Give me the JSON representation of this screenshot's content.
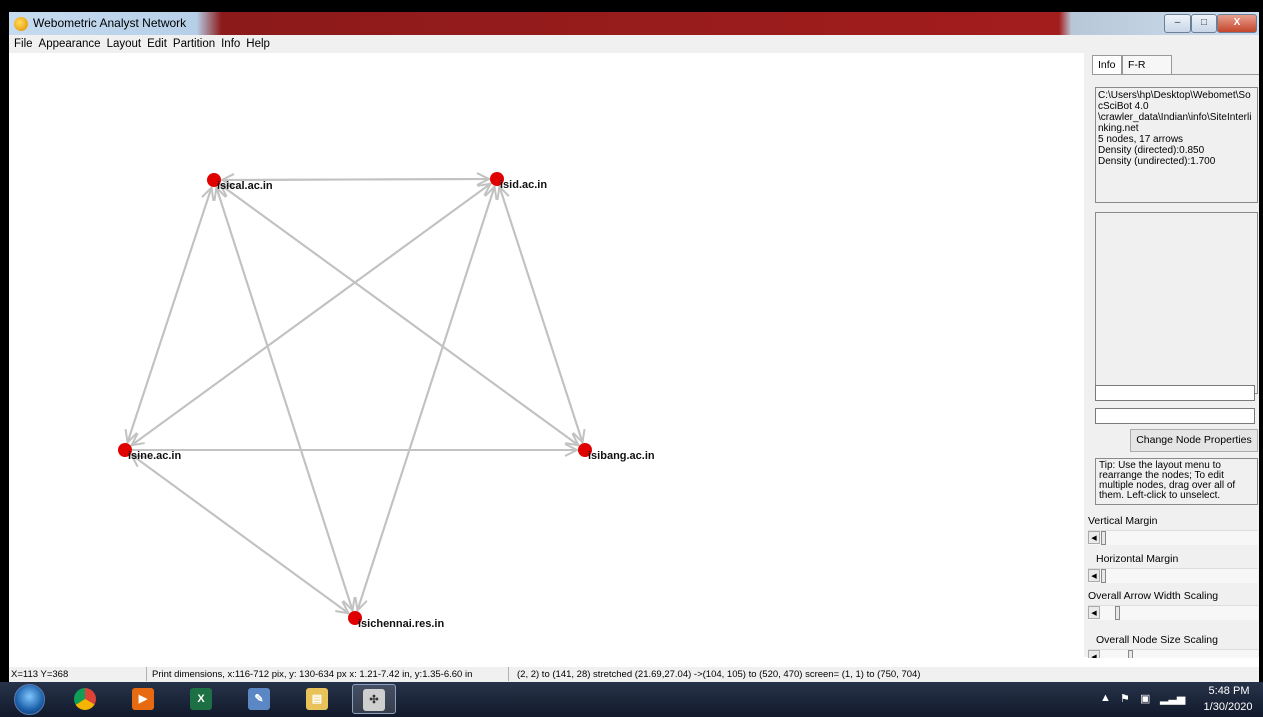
{
  "window": {
    "title": "Webometric Analyst Network",
    "caption_buttons": {
      "minimize": "–",
      "maximize": "□",
      "close": "X"
    }
  },
  "menubar": {
    "items": [
      "File",
      "Appearance",
      "Layout",
      "Edit",
      "Partition",
      "Info",
      "Help"
    ]
  },
  "network": {
    "node_color": "#e00000",
    "edge_color": "#c2c2c2",
    "nodes": [
      {
        "id": "isical",
        "label": "isical.ac.in"
      },
      {
        "id": "isid",
        "label": "isid.ac.in"
      },
      {
        "id": "isine",
        "label": "isine.ac.in"
      },
      {
        "id": "isibang",
        "label": "isibang.ac.in"
      },
      {
        "id": "isichennai",
        "label": "isichennai.res.in"
      }
    ],
    "edges": [
      [
        "isical",
        "isid"
      ],
      [
        "isid",
        "isical"
      ],
      [
        "isical",
        "isine"
      ],
      [
        "isine",
        "isical"
      ],
      [
        "isical",
        "isibang"
      ],
      [
        "isibang",
        "isical"
      ],
      [
        "isichennai",
        "isical"
      ],
      [
        "isid",
        "isibang"
      ],
      [
        "isine",
        "isid"
      ],
      [
        "isid",
        "isine"
      ],
      [
        "isichennai",
        "isid"
      ],
      [
        "isibang",
        "isid"
      ],
      [
        "isine",
        "isibang"
      ],
      [
        "isine",
        "isichennai"
      ],
      [
        "isichennai",
        "isine"
      ],
      [
        "isical",
        "isichennai"
      ],
      [
        "isid",
        "isichennai"
      ]
    ]
  },
  "sidepanel": {
    "tabs": [
      "Info",
      "F-R"
    ],
    "info_lines": [
      "C:\\Users\\hp\\Desktop\\Webomet\\So",
      "cSciBot 4.0",
      "\\crawler_data\\Indian\\info\\SiteInterli",
      "nking.net",
      "5 nodes, 17 arrows",
      "Density (directed):0.850",
      "Density (undirected):1.700"
    ],
    "field1_value": "",
    "field2_value": "",
    "change_node_button": "Change Node Properties",
    "tip_lines": [
      "Tip: Use the layout menu to",
      "rearrange the nodes; To edit",
      "multiple nodes, drag over all of",
      "them. Left-click to unselect."
    ],
    "sliders": {
      "vertical_margin": "Vertical Margin",
      "horizontal_margin": "Horizontal Margin",
      "arrow_width": "Overall Arrow Width Scaling",
      "node_size": "Overall Node Size Scaling"
    }
  },
  "statusbar": {
    "coords": "X=113 Y=368",
    "print_dimensions": "Print dimensions, x:116-712 pix, y: 130-634 px x: 1.21-7.42 in, y:1.35-6.60 in",
    "transform": "(2, 2) to (141, 28) stretched (21.69,27.04) ->(104, 105) to (520, 470)  screen= (1, 1) to (750, 704)"
  },
  "taskbar": {
    "apps": [
      "chrome-icon",
      "media-player-icon",
      "excel-icon",
      "paint-icon",
      "file-explorer-icon",
      "network-app-icon"
    ],
    "time": "5:48 PM",
    "date": "1/30/2020"
  }
}
